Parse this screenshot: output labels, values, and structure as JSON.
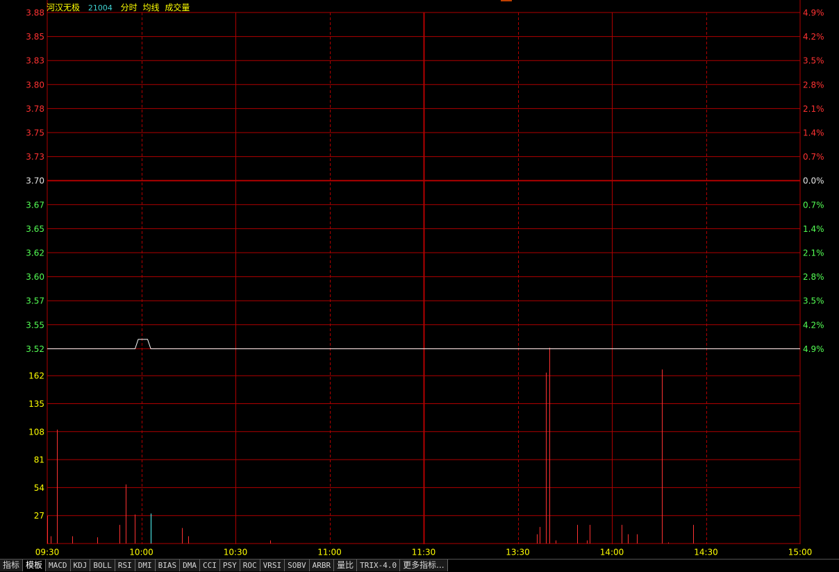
{
  "header": {
    "stock_name": "河汉无极",
    "stock_code": "21004",
    "label_intraday": "分时",
    "label_avg": "均线",
    "label_volume": "成交量"
  },
  "colors": {
    "up": "#ff3232",
    "down": "#54ff54",
    "neutral": "#e6e6e6",
    "grid": "#b00000",
    "price_line": "#ffffff",
    "avg_line": "#ffff00",
    "vol_up": "#ff3232",
    "vol_down": "#54ffff",
    "vol_axis": "#ffff00",
    "time_axis": "#ffff00"
  },
  "chart_data": [
    {
      "type": "line",
      "title": "",
      "price_ticks": [
        "3.88",
        "3.85",
        "3.83",
        "3.80",
        "3.78",
        "3.75",
        "3.73",
        "3.70",
        "3.67",
        "3.65",
        "3.62",
        "3.60",
        "3.57",
        "3.55",
        "3.52"
      ],
      "pct_ticks": [
        "4.9%",
        "4.2%",
        "3.5%",
        "2.8%",
        "2.1%",
        "1.4%",
        "0.7%",
        "0.0%",
        "0.7%",
        "1.4%",
        "2.1%",
        "2.8%",
        "3.5%",
        "4.2%",
        "4.9%"
      ],
      "prev_close": 3.7,
      "ylim": [
        3.52,
        3.88
      ],
      "x_labels": [
        "09:30",
        "10:00",
        "10:30",
        "11:00",
        "11:30",
        "13:30",
        "14:00",
        "14:30",
        "15:00"
      ],
      "price_series": {
        "name": "",
        "points": [
          {
            "t": "09:30",
            "v": 3.52
          },
          {
            "t": "09:58",
            "v": 3.52
          },
          {
            "t": "09:59",
            "v": 3.53
          },
          {
            "t": "10:02",
            "v": 3.53
          },
          {
            "t": "10:03",
            "v": 3.52
          },
          {
            "t": "15:00",
            "v": 3.52
          }
        ]
      }
    },
    {
      "type": "bar",
      "title": "",
      "vol_ticks": [
        "162",
        "135",
        "108",
        "81",
        "54",
        "27"
      ],
      "ylim": [
        0,
        189
      ],
      "bars": [
        {
          "t": "09:30",
          "v": 27,
          "dir": "up"
        },
        {
          "t": "09:31",
          "v": 7,
          "dir": "up"
        },
        {
          "t": "09:33",
          "v": 110,
          "dir": "up"
        },
        {
          "t": "09:38",
          "v": 7,
          "dir": "up"
        },
        {
          "t": "09:46",
          "v": 6,
          "dir": "up"
        },
        {
          "t": "09:53",
          "v": 18,
          "dir": "up"
        },
        {
          "t": "09:55",
          "v": 57,
          "dir": "up"
        },
        {
          "t": "09:58",
          "v": 28,
          "dir": "up"
        },
        {
          "t": "10:03",
          "v": 29,
          "dir": "down"
        },
        {
          "t": "10:13",
          "v": 15,
          "dir": "up"
        },
        {
          "t": "10:15",
          "v": 7,
          "dir": "up"
        },
        {
          "t": "10:41",
          "v": 3,
          "dir": "up"
        },
        {
          "t": "13:36",
          "v": 9,
          "dir": "up"
        },
        {
          "t": "13:37",
          "v": 16,
          "dir": "up"
        },
        {
          "t": "13:39",
          "v": 165,
          "dir": "up"
        },
        {
          "t": "13:40",
          "v": 189,
          "dir": "up"
        },
        {
          "t": "13:42",
          "v": 3,
          "dir": "up"
        },
        {
          "t": "13:49",
          "v": 18,
          "dir": "up"
        },
        {
          "t": "13:52",
          "v": 3,
          "dir": "up"
        },
        {
          "t": "13:53",
          "v": 18,
          "dir": "up"
        },
        {
          "t": "14:03",
          "v": 18,
          "dir": "up"
        },
        {
          "t": "14:05",
          "v": 9,
          "dir": "up"
        },
        {
          "t": "14:08",
          "v": 9,
          "dir": "up"
        },
        {
          "t": "14:16",
          "v": 168,
          "dir": "up"
        },
        {
          "t": "14:18",
          "v": 1,
          "dir": "up"
        },
        {
          "t": "14:26",
          "v": 18,
          "dir": "up"
        }
      ]
    }
  ],
  "tabs": [
    {
      "label": "指标",
      "cjk": true
    },
    {
      "label": "模板",
      "cjk": true
    },
    {
      "label": "MACD"
    },
    {
      "label": "KDJ"
    },
    {
      "label": "BOLL"
    },
    {
      "label": "RSI"
    },
    {
      "label": "DMI"
    },
    {
      "label": "BIAS"
    },
    {
      "label": "DMA"
    },
    {
      "label": "CCI"
    },
    {
      "label": "PSY"
    },
    {
      "label": "ROC"
    },
    {
      "label": "VRSI"
    },
    {
      "label": "SOBV"
    },
    {
      "label": "ARBR"
    },
    {
      "label": "量比",
      "cjk": true
    },
    {
      "label": "TRIX-4.0"
    },
    {
      "label": "更多指标...",
      "cjk": true
    }
  ]
}
